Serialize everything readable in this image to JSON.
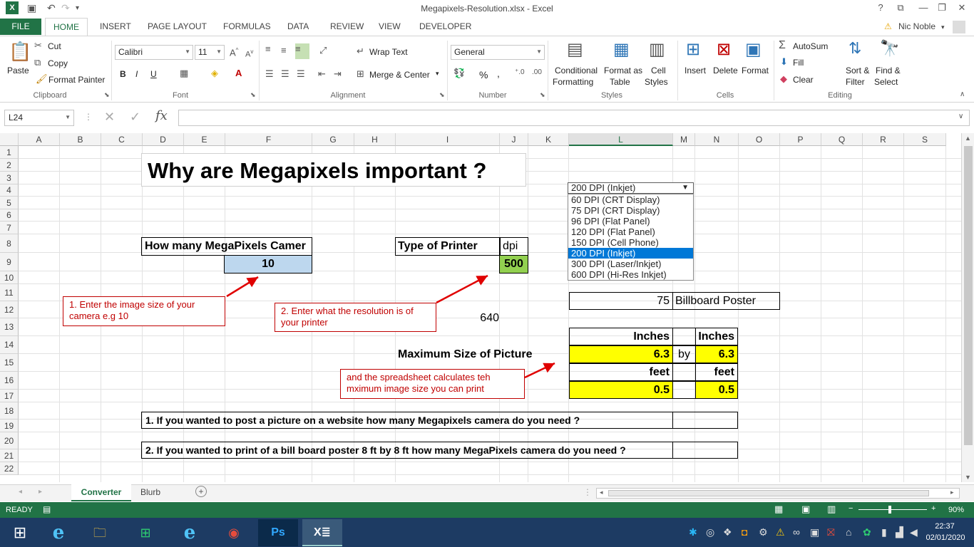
{
  "window": {
    "title": "Megapixels-Resolution.xlsx - Excel",
    "user": "Nic Noble",
    "help": "?",
    "controls": [
      "⧉",
      "—",
      "❐",
      "✕"
    ]
  },
  "tabs": [
    "FILE",
    "HOME",
    "INSERT",
    "PAGE LAYOUT",
    "FORMULAS",
    "DATA",
    "REVIEW",
    "VIEW",
    "DEVELOPER"
  ],
  "ribbon": {
    "clipboard": {
      "paste": "Paste",
      "cut": "Cut",
      "copy": "Copy",
      "format_painter": "Format Painter",
      "label": "Clipboard"
    },
    "font": {
      "name": "Calibri",
      "size": "11",
      "bold": "B",
      "italic": "I",
      "underline": "U",
      "label": "Font"
    },
    "alignment": {
      "wrap": "Wrap Text",
      "merge": "Merge & Center",
      "label": "Alignment"
    },
    "number": {
      "format": "General",
      "percent": "%",
      "comma": ",",
      "label": "Number"
    },
    "styles": {
      "conditional": "Conditional",
      "conditional2": "Formatting",
      "format_as": "Format as",
      "format_as2": "Table",
      "cell": "Cell",
      "cell2": "Styles",
      "label": "Styles"
    },
    "cells": {
      "insert": "Insert",
      "delete": "Delete",
      "format": "Format",
      "label": "Cells"
    },
    "editing": {
      "autosum": "AutoSum",
      "fill": "Fill",
      "clear": "Clear",
      "sort": "Sort &",
      "sort2": "Filter",
      "find": "Find &",
      "find2": "Select",
      "label": "Editing"
    }
  },
  "formula_bar": {
    "name_box": "L24",
    "fx": "fx",
    "value": ""
  },
  "columns": [
    "A",
    "B",
    "C",
    "D",
    "E",
    "F",
    "G",
    "H",
    "I",
    "J",
    "K",
    "L",
    "M",
    "N",
    "O",
    "P",
    "Q",
    "R",
    "S"
  ],
  "rows": [
    "1",
    "2",
    "3",
    "4",
    "5",
    "6",
    "7",
    "8",
    "9",
    "10",
    "11",
    "12",
    "13",
    "14",
    "15",
    "16",
    "17",
    "18",
    "19",
    "20",
    "21",
    "22"
  ],
  "sheet": {
    "title": "Why are Megapixels important ?",
    "megapixels_label": "How many MegaPixels Camer",
    "megapixels_value": "10",
    "printer_label": "Type of Printer",
    "dpi_label": "dpi",
    "dpi_value": "500",
    "note1": "1. Enter the image size of your camera e.g 10",
    "note2": "2. Enter what the resolution is of your printer",
    "note3": "and the spreadsheet calculates teh mximum image size you can print",
    "hidden_value": "640",
    "billboard_num": "75",
    "billboard_label": "Billboard Poster",
    "inches1": "Inches",
    "inches2": "Inches",
    "max_size_label": "Maximum Size of Picture",
    "inch_value1": "6.3",
    "by": "by",
    "inch_value2": "6.3",
    "feet1": "feet",
    "feet2": "feet",
    "feet_value1": "0.5",
    "feet_value2": "0.5",
    "q1": "1. If you wanted to post a picture on a website how many Megapixels camera do you need ?",
    "q2": "2. If you wanted to print of  a bill board poster 8 ft by 8 ft how many MegaPixels camera do you need ?"
  },
  "dropdown": {
    "selected": "200 DPI (Inkjet)",
    "options": [
      "60 DPI (CRT Display)",
      "75 DPI (CRT Display)",
      "96 DPI (Flat Panel)",
      "120 DPI (Flat Panel)",
      "150 DPI (Cell Phone)",
      "200 DPI (Inkjet)",
      "300 DPI (Laser/Inkjet)",
      "600 DPI (Hi-Res Inkjet)"
    ],
    "selected_index": 5
  },
  "sheet_tabs": [
    "Converter",
    "Blurb"
  ],
  "status": {
    "ready": "READY",
    "zoom": "90%"
  },
  "taskbar": {
    "time": "22:37",
    "date": "02/01/2020"
  },
  "colors": {
    "excel_green": "#217346",
    "input_blue": "#bdd7ee",
    "dpi_green": "#92d050",
    "yellow": "#ffff00",
    "note_red": "#c00000"
  }
}
